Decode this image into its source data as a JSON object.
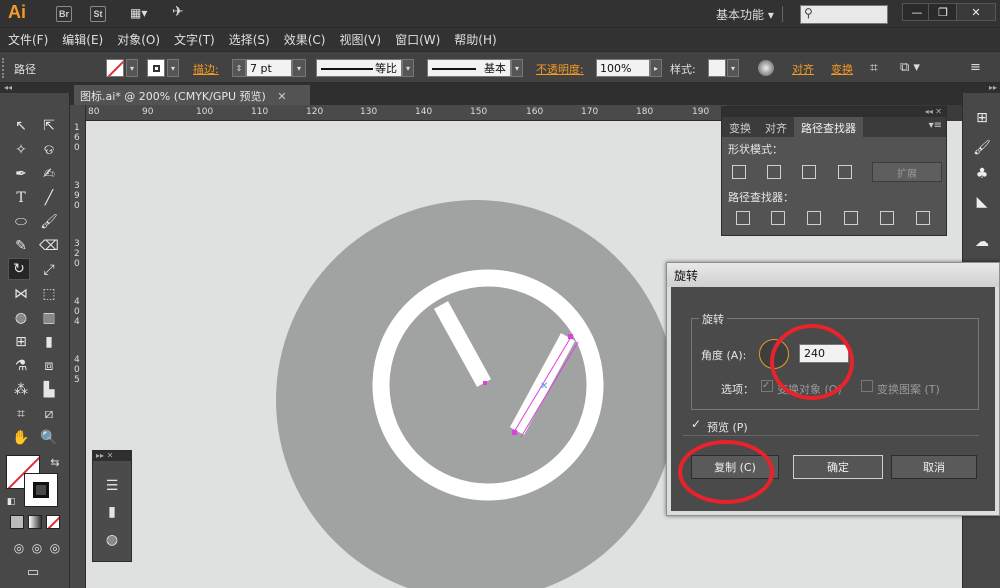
{
  "app": {
    "logo": "Ai",
    "title_icons": [
      "Br",
      "St"
    ],
    "workspace": "基本功能",
    "search_placeholder": ""
  },
  "menu": [
    "文件(F)",
    "编辑(E)",
    "对象(O)",
    "文字(T)",
    "选择(S)",
    "效果(C)",
    "视图(V)",
    "窗口(W)",
    "帮助(H)"
  ],
  "controlbar": {
    "selection_label": "路径",
    "stroke_label": "描边",
    "stroke_value": "7 pt",
    "profile_label": "等比",
    "brush_label": "基本",
    "opacity_label": "不透明度",
    "opacity_value": "100%",
    "style_label": "样式",
    "align_label": "对齐",
    "transform_label": "变换"
  },
  "document": {
    "tab_title": "图标.ai* @ 200% (CMYK/GPU 预览)"
  },
  "ruler": {
    "h_ticks": [
      "80",
      "90",
      "100",
      "110",
      "120",
      "130",
      "140",
      "150",
      "160",
      "170",
      "180",
      "190"
    ],
    "v_ticks": [
      "1",
      "6",
      "0",
      "3",
      "9",
      "0",
      "3",
      "2",
      "0",
      "4",
      "0",
      "4",
      "4",
      "0",
      "5"
    ]
  },
  "pathfinder_panel": {
    "tabs": [
      "变换",
      "对齐",
      "路径查找器"
    ],
    "active_tab": "路径查找器",
    "shape_modes_label": "形状模式：",
    "pathfinders_label": "路径查找器：",
    "expand_label": "扩展"
  },
  "rotate_dialog": {
    "title": "旋转",
    "group_label": "旋转",
    "angle_label": "角度 (A):",
    "angle_value": "240",
    "options_label": "选项：",
    "transform_objects_label": "变换对象 (O)",
    "transform_patterns_label": "变换图案 (T)",
    "preview_label": "预览 (P)",
    "copy_button": "复制 (C)",
    "ok_button": "确定",
    "cancel_button": "取消"
  },
  "colors": {
    "accent_orange": "#f59a23",
    "annotation_red": "#e8232c",
    "selection_magenta": "#e040e0",
    "icon_gray": "#a0a3a2"
  }
}
